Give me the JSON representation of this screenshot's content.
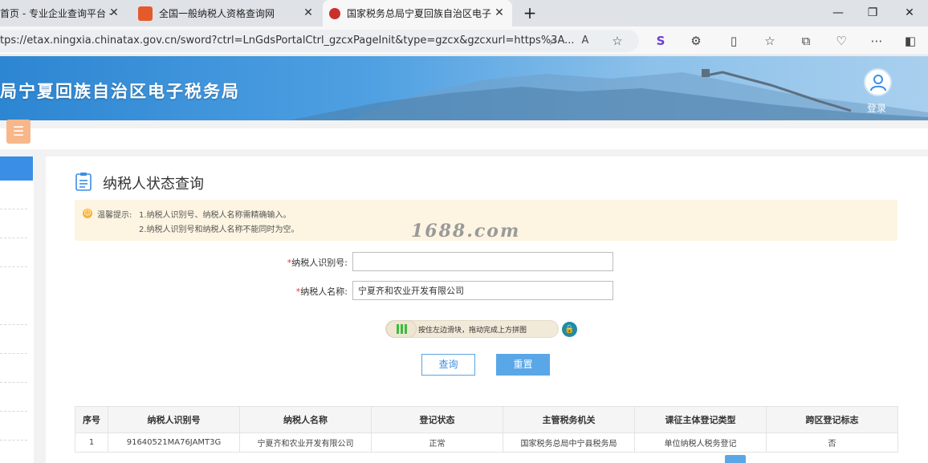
{
  "tabs": [
    {
      "title": "首页 - 专业企业查询平台 -"
    },
    {
      "title": "全国一般纳税人资格查询网"
    },
    {
      "title": "国家税务总局宁夏回族自治区电子"
    }
  ],
  "address": {
    "url": "tps://etax.ningxia.chinatax.gov.cn/sword?ctrl=LnGdsPortalCtrl_gzcxPageInit&type=gzcx&gzcxurl=https%3A..."
  },
  "site": {
    "title": "局宁夏回族自治区电子税务局",
    "login": "登录"
  },
  "panel": {
    "title": "纳税人状态查询"
  },
  "notice": {
    "label": "温馨提示:",
    "line1": "1.纳税人识别号、纳税人名称需精确输入。",
    "line2": "2.纳税人识别号和纳税人名称不能同时为空。"
  },
  "watermark": "1688.com",
  "form": {
    "id_label": "纳税人识别号:",
    "id_value": "",
    "name_label": "纳税人名称:",
    "name_value": "宁夏齐和农业开发有限公司",
    "required_mark": "*",
    "slider_text": "按住左边滑块，拖动完成上方拼图",
    "query_button": "查询",
    "reset_button": "重置"
  },
  "table": {
    "headers": [
      "序号",
      "纳税人识别号",
      "纳税人名称",
      "登记状态",
      "主管税务机关",
      "课征主体登记类型",
      "跨区登记标志"
    ],
    "rows": [
      [
        "1",
        "91640521MA76JAMT3G",
        "宁夏齐和农业开发有限公司",
        "正常",
        "国家税务总局中宁县税务局",
        "单位纳税人税务登记",
        "否"
      ]
    ]
  },
  "colors": {
    "accent": "#3a8ee6",
    "header_blue": "#2d86d2",
    "notice_bg": "#fdf5e2"
  }
}
